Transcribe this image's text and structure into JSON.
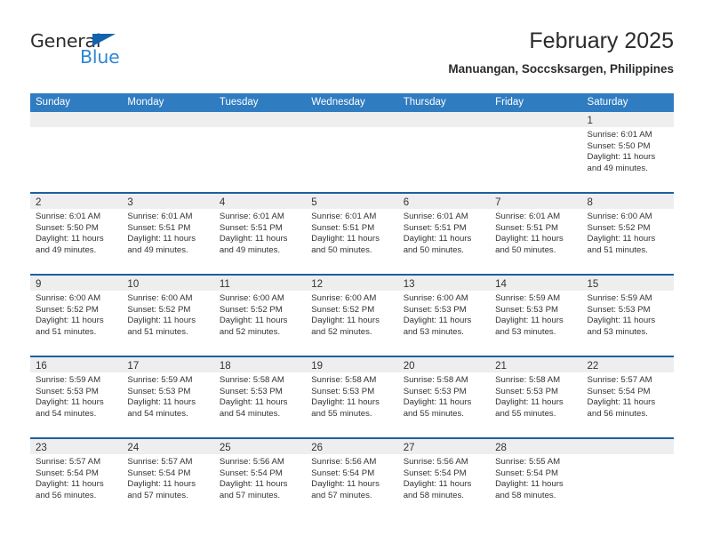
{
  "brand": {
    "name_part1": "General",
    "name_part2": "Blue",
    "triangle_color": "#1263ae",
    "blue_color": "#2e86d6"
  },
  "header": {
    "title": "February 2025",
    "subtitle": "Manuangan, Soccsksargen, Philippines"
  },
  "theme": {
    "header_bg": "#2f7cc1",
    "row_divider": "#1f5fa0",
    "day_band": "#eeeeee"
  },
  "weekdays": [
    "Sunday",
    "Monday",
    "Tuesday",
    "Wednesday",
    "Thursday",
    "Friday",
    "Saturday"
  ],
  "weeks": [
    [
      {
        "date": ""
      },
      {
        "date": ""
      },
      {
        "date": ""
      },
      {
        "date": ""
      },
      {
        "date": ""
      },
      {
        "date": ""
      },
      {
        "date": "1",
        "sunrise": "Sunrise: 6:01 AM",
        "sunset": "Sunset: 5:50 PM",
        "daylight1": "Daylight: 11 hours",
        "daylight2": "and 49 minutes."
      }
    ],
    [
      {
        "date": "2",
        "sunrise": "Sunrise: 6:01 AM",
        "sunset": "Sunset: 5:50 PM",
        "daylight1": "Daylight: 11 hours",
        "daylight2": "and 49 minutes."
      },
      {
        "date": "3",
        "sunrise": "Sunrise: 6:01 AM",
        "sunset": "Sunset: 5:51 PM",
        "daylight1": "Daylight: 11 hours",
        "daylight2": "and 49 minutes."
      },
      {
        "date": "4",
        "sunrise": "Sunrise: 6:01 AM",
        "sunset": "Sunset: 5:51 PM",
        "daylight1": "Daylight: 11 hours",
        "daylight2": "and 49 minutes."
      },
      {
        "date": "5",
        "sunrise": "Sunrise: 6:01 AM",
        "sunset": "Sunset: 5:51 PM",
        "daylight1": "Daylight: 11 hours",
        "daylight2": "and 50 minutes."
      },
      {
        "date": "6",
        "sunrise": "Sunrise: 6:01 AM",
        "sunset": "Sunset: 5:51 PM",
        "daylight1": "Daylight: 11 hours",
        "daylight2": "and 50 minutes."
      },
      {
        "date": "7",
        "sunrise": "Sunrise: 6:01 AM",
        "sunset": "Sunset: 5:51 PM",
        "daylight1": "Daylight: 11 hours",
        "daylight2": "and 50 minutes."
      },
      {
        "date": "8",
        "sunrise": "Sunrise: 6:00 AM",
        "sunset": "Sunset: 5:52 PM",
        "daylight1": "Daylight: 11 hours",
        "daylight2": "and 51 minutes."
      }
    ],
    [
      {
        "date": "9",
        "sunrise": "Sunrise: 6:00 AM",
        "sunset": "Sunset: 5:52 PM",
        "daylight1": "Daylight: 11 hours",
        "daylight2": "and 51 minutes."
      },
      {
        "date": "10",
        "sunrise": "Sunrise: 6:00 AM",
        "sunset": "Sunset: 5:52 PM",
        "daylight1": "Daylight: 11 hours",
        "daylight2": "and 51 minutes."
      },
      {
        "date": "11",
        "sunrise": "Sunrise: 6:00 AM",
        "sunset": "Sunset: 5:52 PM",
        "daylight1": "Daylight: 11 hours",
        "daylight2": "and 52 minutes."
      },
      {
        "date": "12",
        "sunrise": "Sunrise: 6:00 AM",
        "sunset": "Sunset: 5:52 PM",
        "daylight1": "Daylight: 11 hours",
        "daylight2": "and 52 minutes."
      },
      {
        "date": "13",
        "sunrise": "Sunrise: 6:00 AM",
        "sunset": "Sunset: 5:53 PM",
        "daylight1": "Daylight: 11 hours",
        "daylight2": "and 53 minutes."
      },
      {
        "date": "14",
        "sunrise": "Sunrise: 5:59 AM",
        "sunset": "Sunset: 5:53 PM",
        "daylight1": "Daylight: 11 hours",
        "daylight2": "and 53 minutes."
      },
      {
        "date": "15",
        "sunrise": "Sunrise: 5:59 AM",
        "sunset": "Sunset: 5:53 PM",
        "daylight1": "Daylight: 11 hours",
        "daylight2": "and 53 minutes."
      }
    ],
    [
      {
        "date": "16",
        "sunrise": "Sunrise: 5:59 AM",
        "sunset": "Sunset: 5:53 PM",
        "daylight1": "Daylight: 11 hours",
        "daylight2": "and 54 minutes."
      },
      {
        "date": "17",
        "sunrise": "Sunrise: 5:59 AM",
        "sunset": "Sunset: 5:53 PM",
        "daylight1": "Daylight: 11 hours",
        "daylight2": "and 54 minutes."
      },
      {
        "date": "18",
        "sunrise": "Sunrise: 5:58 AM",
        "sunset": "Sunset: 5:53 PM",
        "daylight1": "Daylight: 11 hours",
        "daylight2": "and 54 minutes."
      },
      {
        "date": "19",
        "sunrise": "Sunrise: 5:58 AM",
        "sunset": "Sunset: 5:53 PM",
        "daylight1": "Daylight: 11 hours",
        "daylight2": "and 55 minutes."
      },
      {
        "date": "20",
        "sunrise": "Sunrise: 5:58 AM",
        "sunset": "Sunset: 5:53 PM",
        "daylight1": "Daylight: 11 hours",
        "daylight2": "and 55 minutes."
      },
      {
        "date": "21",
        "sunrise": "Sunrise: 5:58 AM",
        "sunset": "Sunset: 5:53 PM",
        "daylight1": "Daylight: 11 hours",
        "daylight2": "and 55 minutes."
      },
      {
        "date": "22",
        "sunrise": "Sunrise: 5:57 AM",
        "sunset": "Sunset: 5:54 PM",
        "daylight1": "Daylight: 11 hours",
        "daylight2": "and 56 minutes."
      }
    ],
    [
      {
        "date": "23",
        "sunrise": "Sunrise: 5:57 AM",
        "sunset": "Sunset: 5:54 PM",
        "daylight1": "Daylight: 11 hours",
        "daylight2": "and 56 minutes."
      },
      {
        "date": "24",
        "sunrise": "Sunrise: 5:57 AM",
        "sunset": "Sunset: 5:54 PM",
        "daylight1": "Daylight: 11 hours",
        "daylight2": "and 57 minutes."
      },
      {
        "date": "25",
        "sunrise": "Sunrise: 5:56 AM",
        "sunset": "Sunset: 5:54 PM",
        "daylight1": "Daylight: 11 hours",
        "daylight2": "and 57 minutes."
      },
      {
        "date": "26",
        "sunrise": "Sunrise: 5:56 AM",
        "sunset": "Sunset: 5:54 PM",
        "daylight1": "Daylight: 11 hours",
        "daylight2": "and 57 minutes."
      },
      {
        "date": "27",
        "sunrise": "Sunrise: 5:56 AM",
        "sunset": "Sunset: 5:54 PM",
        "daylight1": "Daylight: 11 hours",
        "daylight2": "and 58 minutes."
      },
      {
        "date": "28",
        "sunrise": "Sunrise: 5:55 AM",
        "sunset": "Sunset: 5:54 PM",
        "daylight1": "Daylight: 11 hours",
        "daylight2": "and 58 minutes."
      },
      {
        "date": ""
      }
    ]
  ]
}
